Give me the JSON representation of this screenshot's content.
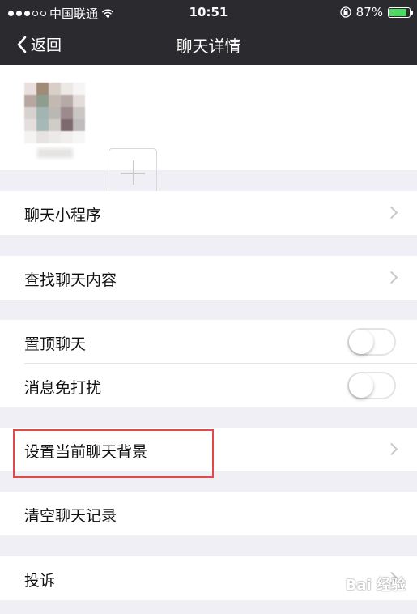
{
  "status_bar": {
    "carrier": "中国联通",
    "time": "10:51",
    "battery": "87%",
    "battery_level": 0.87,
    "signal_icon": "signal-dots-icon",
    "wifi_icon": "wifi-icon",
    "lock_icon": "rotation-lock-icon"
  },
  "nav": {
    "back_label": "返回",
    "title": "聊天详情"
  },
  "members": {
    "add_icon": "plus-icon"
  },
  "rows": {
    "mini_program": "聊天小程序",
    "search_content": "查找聊天内容",
    "pin_chat": "置顶聊天",
    "mute": "消息免打扰",
    "set_background": "设置当前聊天背景",
    "clear_history": "清空聊天记录",
    "complaint": "投诉"
  },
  "toggles": {
    "pin_chat_on": false,
    "mute_on": false
  },
  "watermark": "Bai 经验",
  "colors": {
    "nav_bg": "#2b2b2f",
    "page_bg": "#f0eff5",
    "battery_green": "#4cd964",
    "highlight_red": "#e04a4a"
  }
}
